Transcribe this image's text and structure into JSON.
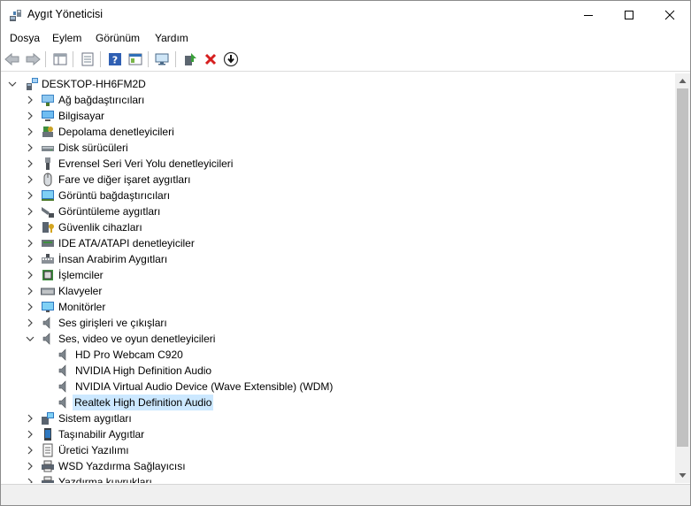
{
  "window": {
    "title": "Aygıt Yöneticisi"
  },
  "menu": {
    "items": [
      "Dosya",
      "Eylem",
      "Görünüm",
      "Yardım"
    ]
  },
  "tree": {
    "root": "DESKTOP-HH6FM2D",
    "items": [
      {
        "label": "Ağ bağdaştırıcıları",
        "icon": "network-adapter-icon"
      },
      {
        "label": "Bilgisayar",
        "icon": "computer-icon"
      },
      {
        "label": "Depolama denetleyicileri",
        "icon": "storage-controller-icon"
      },
      {
        "label": "Disk sürücüleri",
        "icon": "disk-drive-icon"
      },
      {
        "label": "Evrensel Seri Veri Yolu denetleyicileri",
        "icon": "usb-icon"
      },
      {
        "label": "Fare ve diğer işaret aygıtları",
        "icon": "mouse-icon"
      },
      {
        "label": "Görüntü bağdaştırıcıları",
        "icon": "display-adapter-icon"
      },
      {
        "label": "Görüntüleme aygıtları",
        "icon": "camera-icon"
      },
      {
        "label": "Güvenlik cihazları",
        "icon": "security-device-icon"
      },
      {
        "label": "IDE ATA/ATAPI denetleyiciler",
        "icon": "ide-controller-icon"
      },
      {
        "label": "İnsan Arabirim Aygıtları",
        "icon": "hid-icon"
      },
      {
        "label": "İşlemciler",
        "icon": "processor-icon"
      },
      {
        "label": "Klavyeler",
        "icon": "keyboard-icon"
      },
      {
        "label": "Monitörler",
        "icon": "monitor-icon"
      },
      {
        "label": "Ses girişleri ve çıkışları",
        "icon": "speaker-icon"
      },
      {
        "label": "Ses, video ve oyun denetleyicileri",
        "icon": "speaker-icon",
        "expanded": true,
        "children": [
          {
            "label": "HD Pro Webcam C920",
            "icon": "speaker-icon"
          },
          {
            "label": "NVIDIA High Definition Audio",
            "icon": "speaker-icon"
          },
          {
            "label": "NVIDIA Virtual Audio Device (Wave Extensible) (WDM)",
            "icon": "speaker-icon"
          },
          {
            "label": "Realtek High Definition Audio",
            "icon": "speaker-icon",
            "selected": true
          }
        ]
      },
      {
        "label": "Sistem aygıtları",
        "icon": "system-device-icon"
      },
      {
        "label": "Taşınabilir Aygıtlar",
        "icon": "portable-device-icon"
      },
      {
        "label": "Üretici Yazılımı",
        "icon": "firmware-icon"
      },
      {
        "label": "WSD Yazdırma Sağlayıcısı",
        "icon": "printer-icon"
      },
      {
        "label": "Yazdırma kuyrukları",
        "icon": "printer-icon"
      }
    ]
  }
}
